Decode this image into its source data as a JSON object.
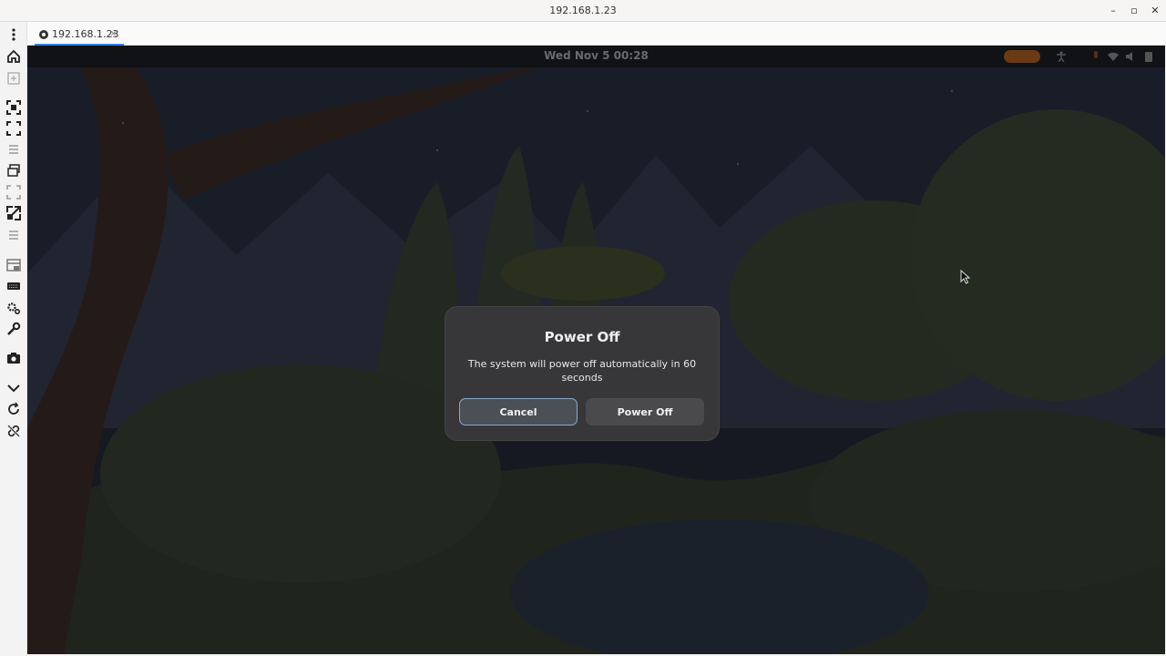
{
  "window": {
    "title": "192.168.1.23",
    "minimize_label": "–",
    "maximize_label": "▫",
    "close_label": "✕"
  },
  "tab": {
    "label": "192.168.1.23",
    "close_label": "×"
  },
  "remote": {
    "clock": "Wed Nov 5  00:28",
    "dialog": {
      "title": "Power Off",
      "body": "The system will power off automatically in 60 seconds",
      "cancel_label": "Cancel",
      "poweroff_label": "Power Off"
    }
  },
  "colors": {
    "accent": "#3584e4",
    "dialog_bg": "#373739",
    "button_bg": "#4a4a4d"
  },
  "toolbar_icons": [
    "menu-dots-icon",
    "home-icon",
    "new-tab-icon",
    "fit-screen-icon",
    "fullscreen-icon",
    "list-icon",
    "windows-icon",
    "scale-icon",
    "resize-icon",
    "menu-icon",
    "view-icon",
    "keyboard-icon",
    "preferences-icon",
    "tools-icon",
    "screenshot-icon",
    "collapse-icon",
    "refresh-icon",
    "disconnect-icon"
  ]
}
